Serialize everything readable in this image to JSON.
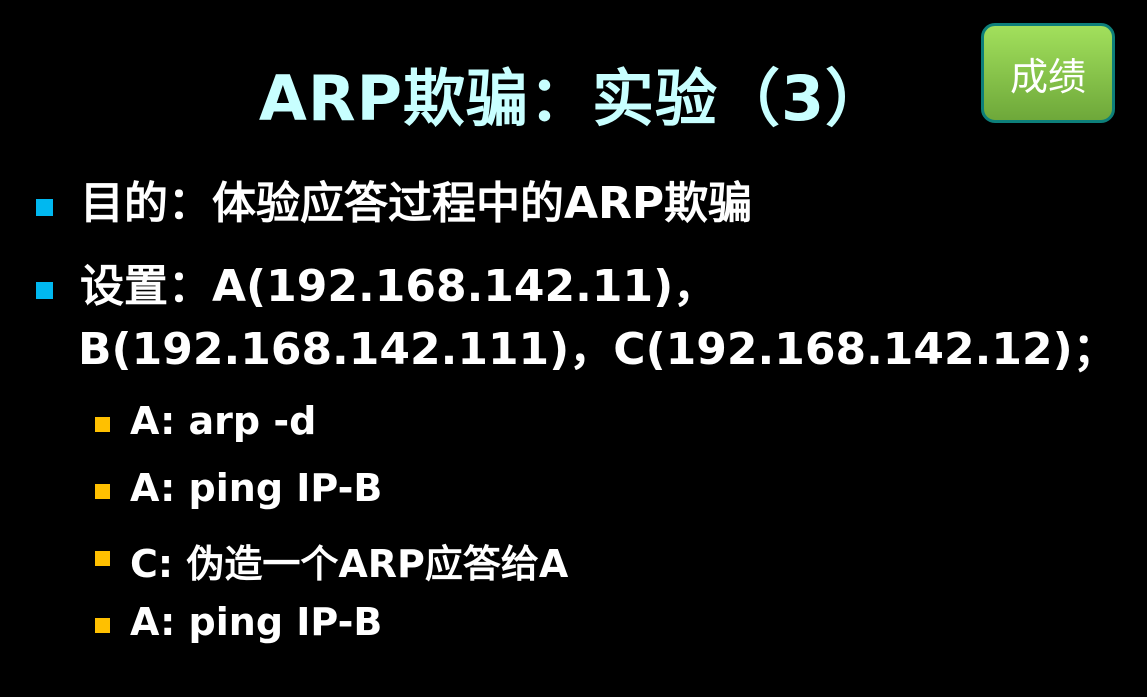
{
  "slide": {
    "title": "ARP欺骗：实验（3）",
    "score_button": "成绩",
    "bullets": [
      {
        "text": "目的：体验应答过程中的ARP欺骗"
      },
      {
        "line1": "设置：A(192.168.142.11)，",
        "line2": "B(192.168.142.111)，C(192.168.142.12)；"
      }
    ],
    "sub_bullets": [
      "A: arp -d",
      "A: ping IP-B",
      "C: 伪造一个ARP应答给A",
      "A: ping IP-B"
    ],
    "colors": {
      "title": "#c8ffff",
      "bullet_level1": "#00b8f0",
      "bullet_level2": "#ffc000",
      "button": "#8fd14f"
    }
  }
}
